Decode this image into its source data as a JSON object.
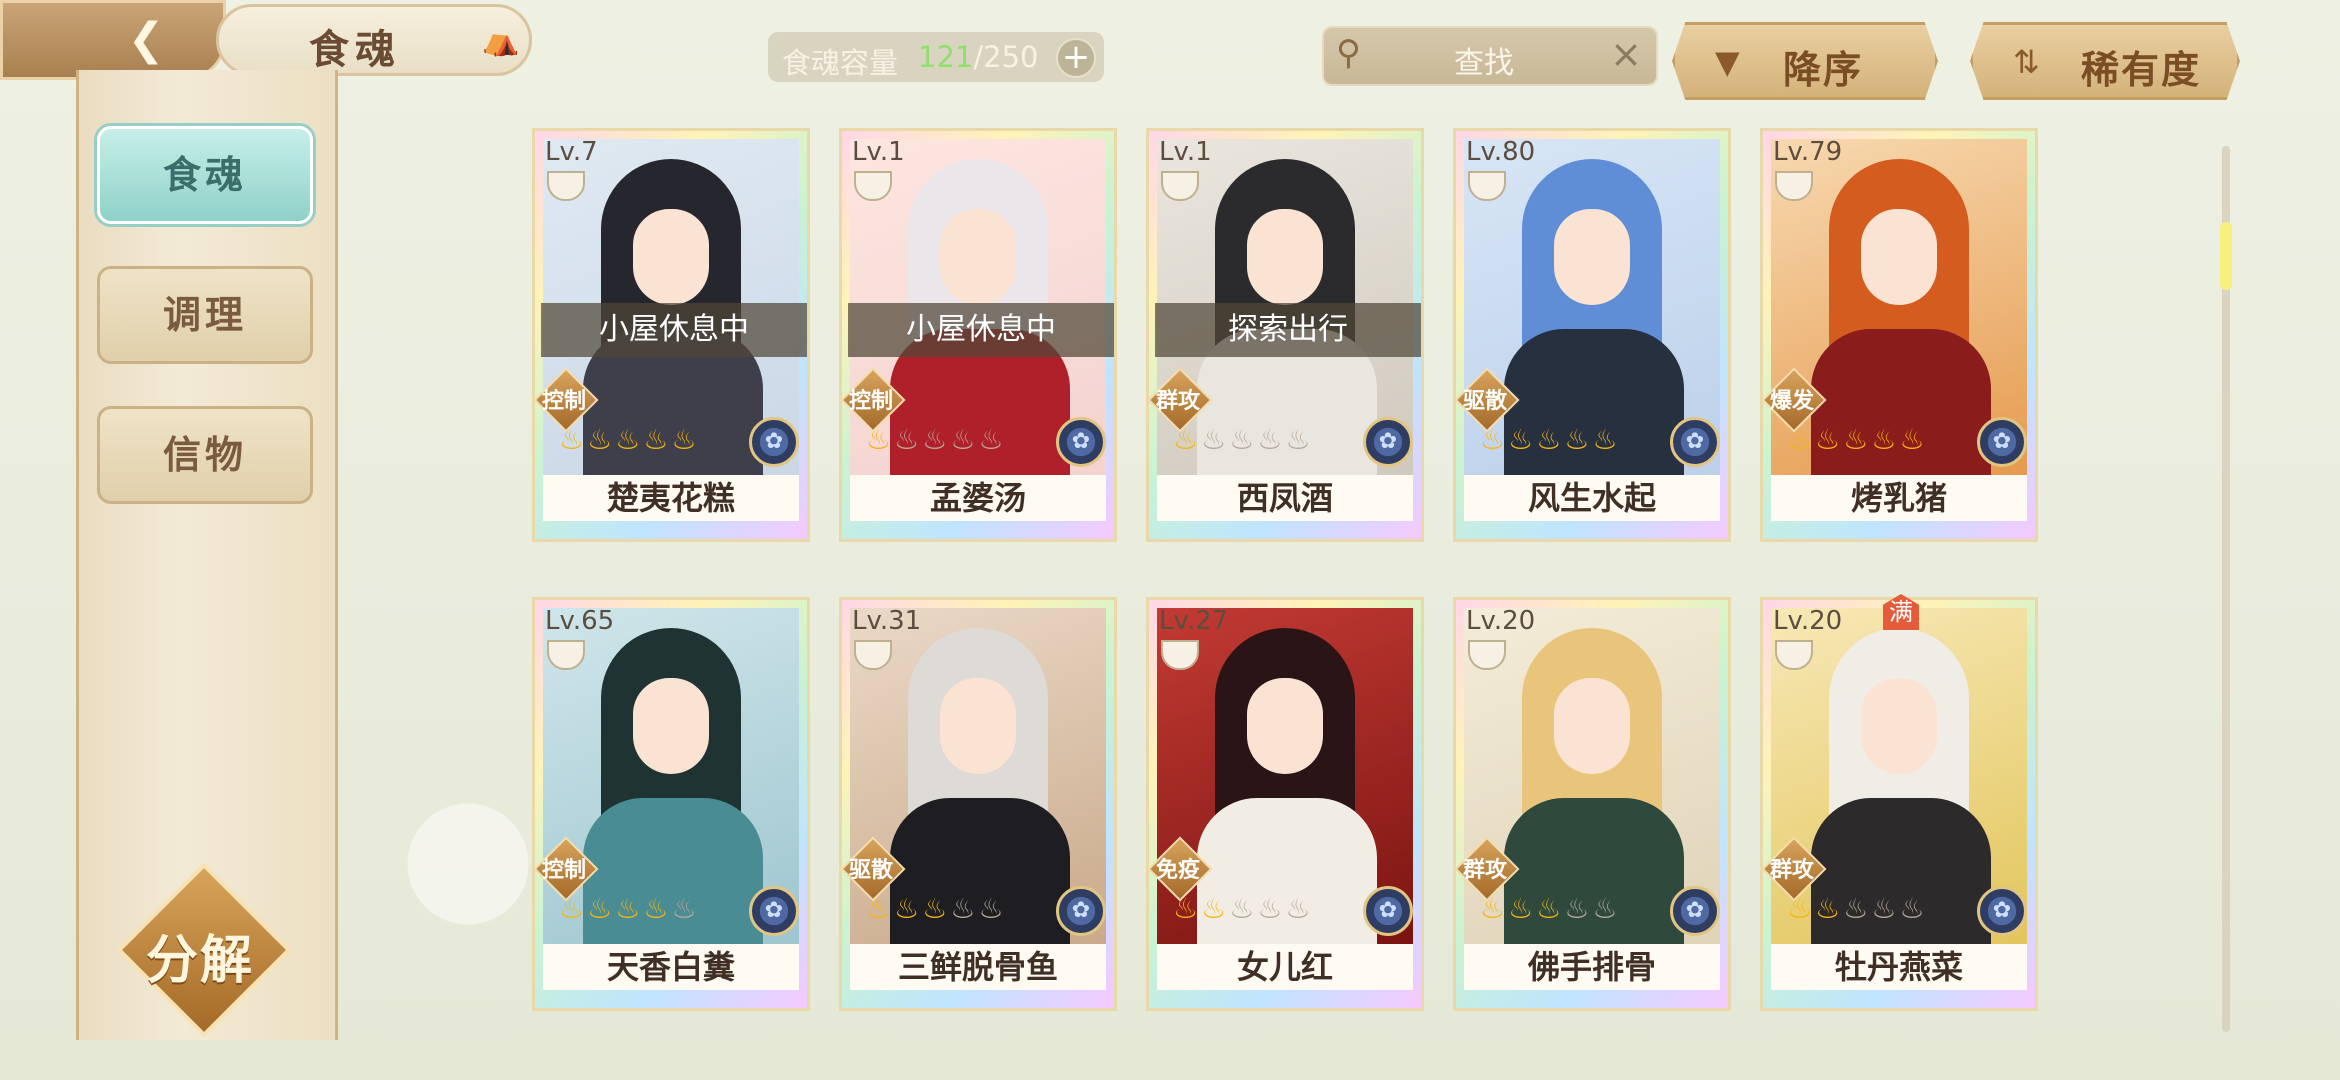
{
  "header": {
    "title": "食魂",
    "capacity_label": "食魂容量",
    "capacity_current": "121",
    "capacity_sep_max": "/250",
    "capacity_add": "+",
    "search_placeholder": "查找",
    "search_clear": "×",
    "sort_order_label": "降序",
    "sort_order_icon": "▼",
    "sort_key_label": "稀有度",
    "sort_key_icon": "⇅",
    "back_icon": "back-arrow-icon",
    "home_icon": "pavilion-icon"
  },
  "sidebar": {
    "tabs": [
      {
        "label": "食魂",
        "active": true
      },
      {
        "label": "调理",
        "active": false
      },
      {
        "label": "信物",
        "active": false
      }
    ],
    "decompose_label": "分解"
  },
  "cards": [
    {
      "lv": "Lv.7",
      "name": "楚夷花糕",
      "status": "小屋休息中",
      "role": "控制",
      "stars": 5,
      "badge": ""
    },
    {
      "lv": "Lv.1",
      "name": "孟婆汤",
      "status": "小屋休息中",
      "role": "控制",
      "stars": 1,
      "badge": ""
    },
    {
      "lv": "Lv.1",
      "name": "西凤酒",
      "status": "探索出行",
      "role": "群攻",
      "stars": 1,
      "badge": ""
    },
    {
      "lv": "Lv.80",
      "name": "风生水起",
      "status": "",
      "role": "驱散",
      "stars": 5,
      "badge": ""
    },
    {
      "lv": "Lv.79",
      "name": "烤乳猪",
      "status": "",
      "role": "爆发",
      "stars": 5,
      "badge": ""
    },
    {
      "lv": "Lv.65",
      "name": "天香白糞",
      "status": "",
      "role": "控制",
      "stars": 4,
      "badge": ""
    },
    {
      "lv": "Lv.31",
      "name": "三鲜脱骨鱼",
      "status": "",
      "role": "驱散",
      "stars": 3,
      "badge": ""
    },
    {
      "lv": "Lv.27",
      "name": "女儿红",
      "status": "",
      "role": "免疫",
      "stars": 2,
      "badge": ""
    },
    {
      "lv": "Lv.20",
      "name": "佛手排骨",
      "status": "",
      "role": "群攻",
      "stars": 3,
      "badge": ""
    },
    {
      "lv": "Lv.20",
      "name": "牡丹燕菜",
      "status": "",
      "role": "群攻",
      "stars": 2,
      "badge": "满"
    }
  ],
  "colors": {
    "accent_active_tab": "#8fd1c9",
    "flame_on": "#f5b414",
    "flame_off": "#b6a99a",
    "capacity_current": "#8fe06a"
  }
}
